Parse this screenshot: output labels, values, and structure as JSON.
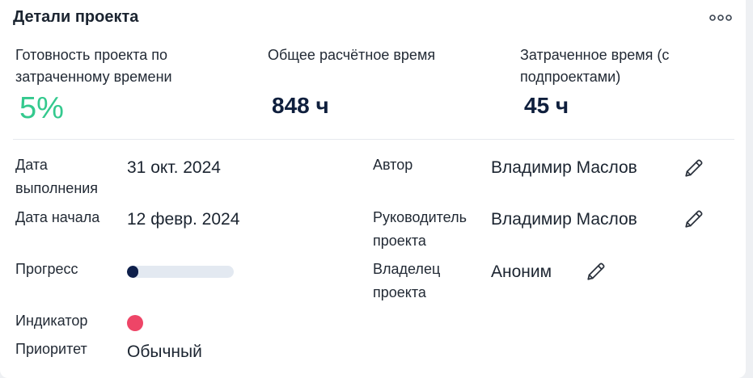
{
  "card": {
    "title": "Детали проекта",
    "menu_icon": "more-horizontal-icon"
  },
  "metrics": [
    {
      "label": "Готовность проекта по затраченному времени",
      "value": "5%"
    },
    {
      "label": "Общее расчётное время",
      "value": "848 ч"
    },
    {
      "label": "Затраченное время (с подпроектами)",
      "value": "45 ч"
    }
  ],
  "details": {
    "due_date_label": "Дата выполнения",
    "due_date": "31 окт. 2024",
    "start_date_label": "Дата начала",
    "start_date": "12 февр. 2024",
    "progress_label": "Прогресс",
    "progress_fraction": 0.05,
    "indicator_label": "Индикатор",
    "indicator_color": "#ee4567",
    "priority_label": "Приоритет",
    "priority": "Обычный",
    "author_label": "Автор",
    "author": "Владимир Маслов",
    "manager_label": "Руководитель проекта",
    "manager": "Владимир Маслов",
    "owner_label": "Владелец проекта",
    "owner": "Аноним",
    "edit_icon": "pencil-icon"
  },
  "colors": {
    "accent_green": "#34c98e",
    "progress_fill": "#0e1f4b",
    "progress_track": "#e3e9f1"
  }
}
